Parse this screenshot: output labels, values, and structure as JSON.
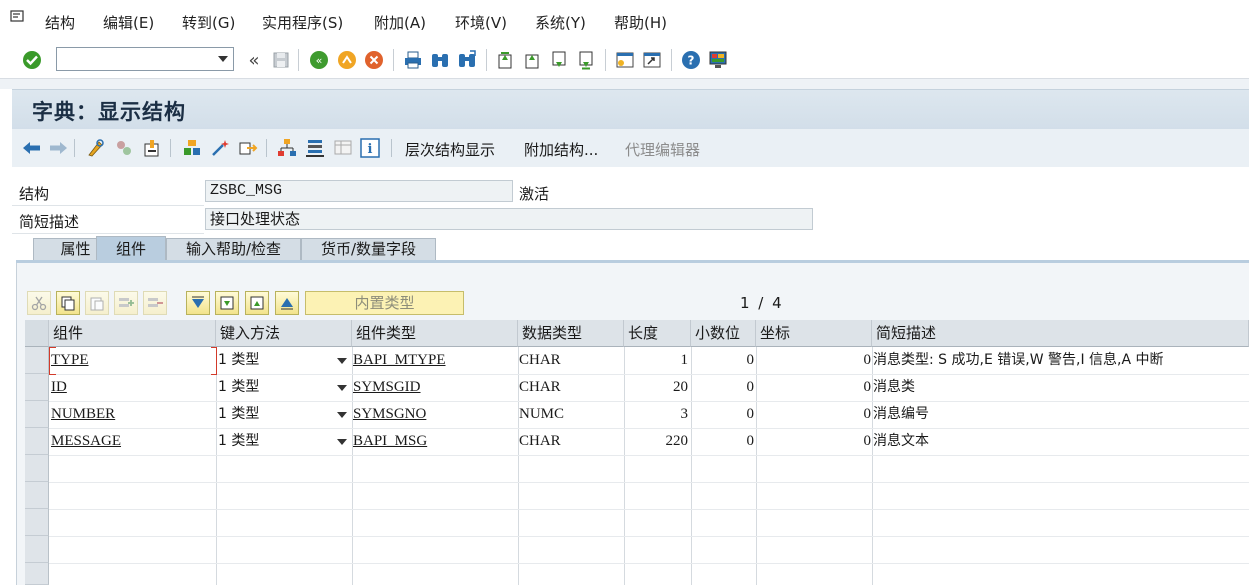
{
  "menubar": {
    "items": [
      "结构",
      "编辑(E)",
      "转到(G)",
      "实用程序(S)",
      "附加(A)",
      "环境(V)",
      "系统(Y)",
      "帮助(H)"
    ]
  },
  "toolbar1": {
    "command_value": "",
    "icons": [
      "enter-icon",
      "back-nav-icon",
      "save-icon",
      "back-icon",
      "exit-icon",
      "cancel-icon",
      "print-icon",
      "find-icon",
      "find-next-icon",
      "first-page-icon",
      "previous-page-icon",
      "next-page-icon",
      "last-page-icon",
      "create-session-icon",
      "shortcut-icon",
      "help-icon",
      "customize-layout-icon"
    ]
  },
  "screen": {
    "title": "字典：显示结构"
  },
  "toolbar2": {
    "hierarchy_label": "层次结构显示",
    "append_label": "附加结构...",
    "proxy_label": "代理编辑器"
  },
  "form": {
    "structure_label": "结构",
    "structure_value": "ZSBC_MSG",
    "status": "激活",
    "short_desc_label": "简短描述",
    "short_desc_value": "接口处理状态"
  },
  "tabs": [
    "属性",
    "组件",
    "输入帮助/检查",
    "货币/数量字段"
  ],
  "active_tab": "组件",
  "table_toolbar": {
    "builtin_label": "内置类型",
    "page_indicator": "1 / 4"
  },
  "table": {
    "columns": [
      "组件",
      "键入方法",
      "组件类型",
      "数据类型",
      "长度",
      "小数位",
      "坐标",
      "简短描述"
    ],
    "rows": [
      {
        "component": "TYPE",
        "typing": "1 类型",
        "comp_type": "BAPI_MTYPE",
        "data_type": "CHAR",
        "length": "1",
        "decimals": "0",
        "coord": "0",
        "desc": "消息类型: S 成功,E 错误,W 警告,I 信息,A 中断"
      },
      {
        "component": "ID",
        "typing": "1 类型",
        "comp_type": "SYMSGID",
        "data_type": "CHAR",
        "length": "20",
        "decimals": "0",
        "coord": "0",
        "desc": "消息类"
      },
      {
        "component": "NUMBER",
        "typing": "1 类型",
        "comp_type": "SYMSGNO",
        "data_type": "NUMC",
        "length": "3",
        "decimals": "0",
        "coord": "0",
        "desc": "消息编号"
      },
      {
        "component": "MESSAGE",
        "typing": "1 类型",
        "comp_type": "BAPI_MSG",
        "data_type": "CHAR",
        "length": "220",
        "decimals": "0",
        "coord": "0",
        "desc": "消息文本"
      }
    ]
  },
  "colors": {
    "title_bg": "#d2dee9",
    "tab_active": "#b9cddf",
    "button_yellow": "#fcf2b4",
    "green_ok": "#3a9a2a"
  }
}
